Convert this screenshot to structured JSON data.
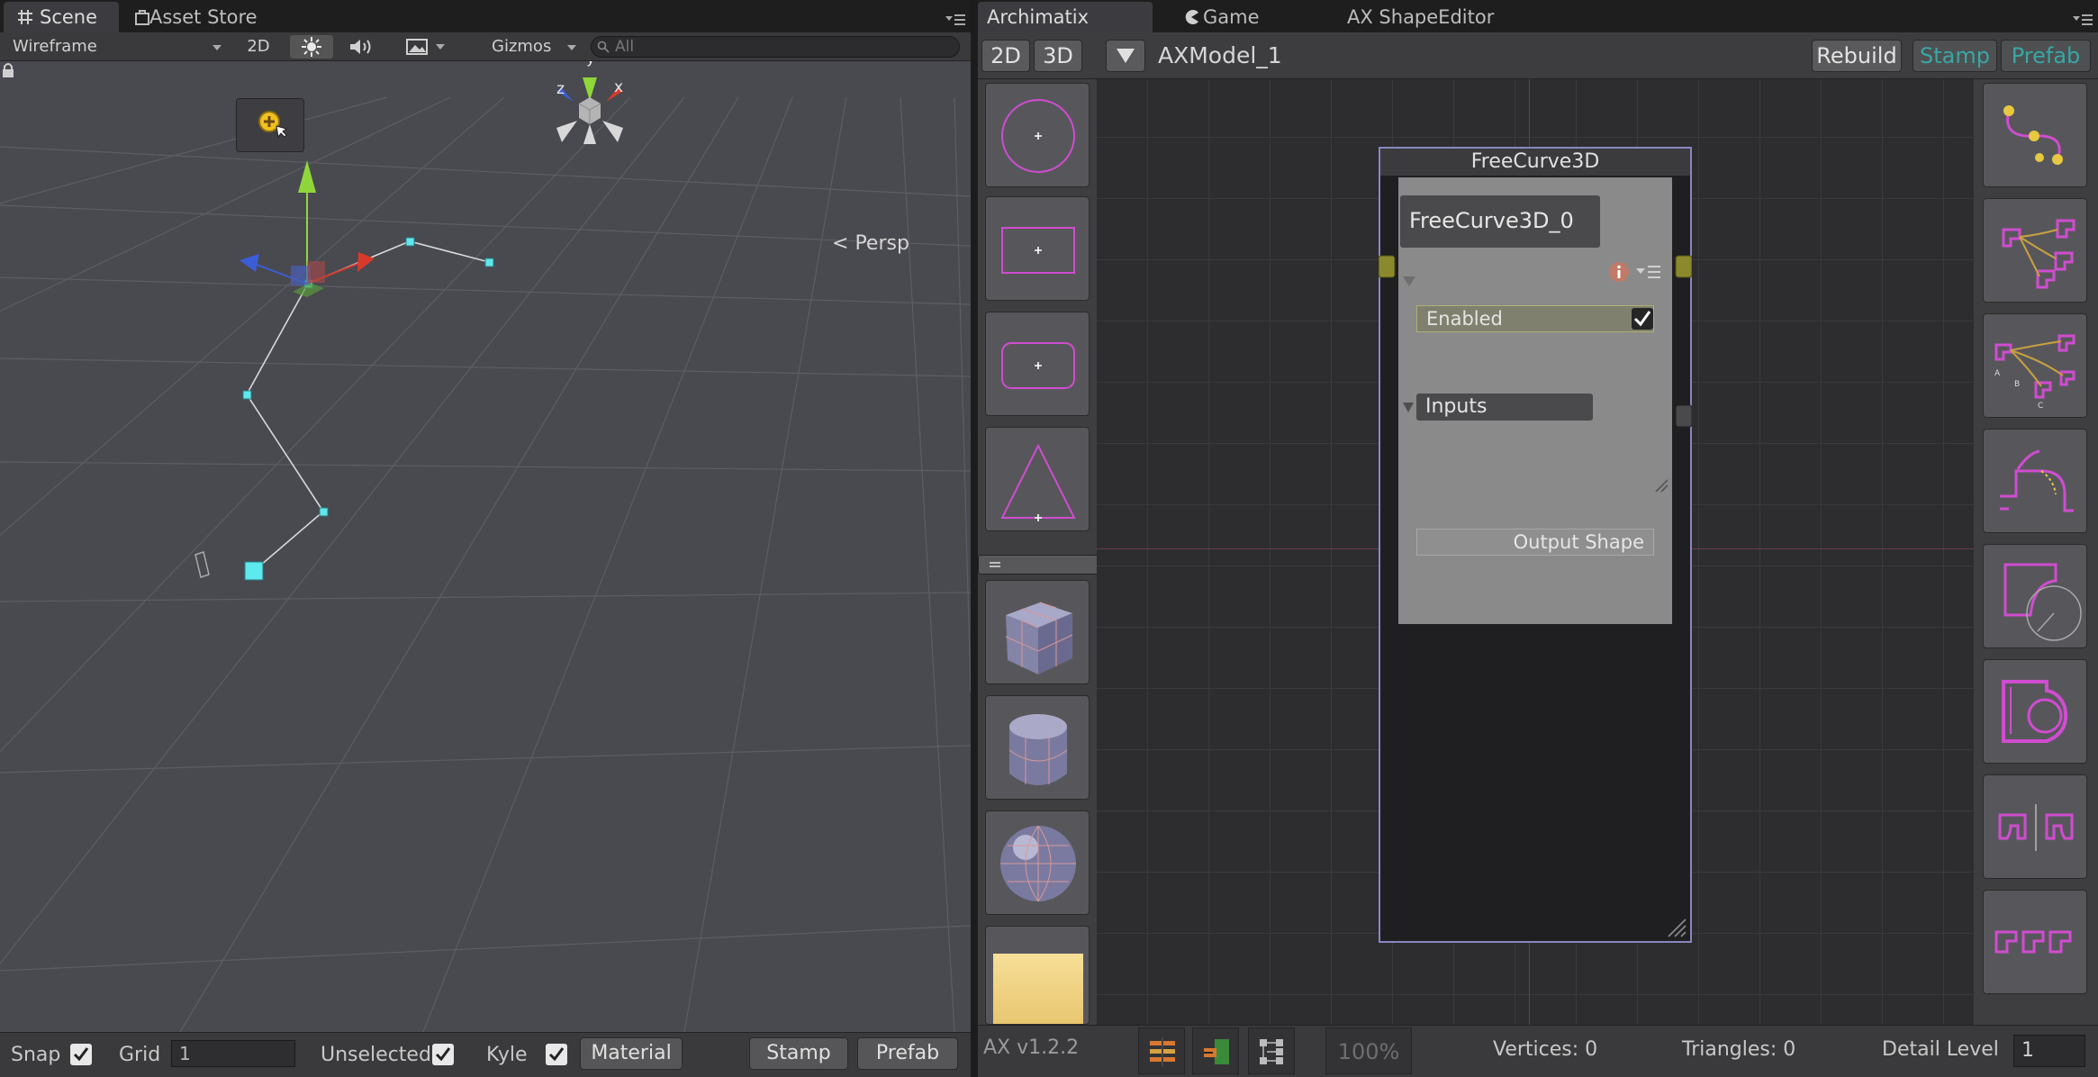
{
  "scene": {
    "tabs": [
      {
        "label": "Scene",
        "icon": "grid-icon",
        "active": true
      },
      {
        "label": "Asset Store",
        "icon": "store-bag-icon",
        "active": false
      }
    ],
    "toolbar": {
      "render_mode": "Wireframe",
      "mode_2d": "2D",
      "lighting_icon": "sun-icon",
      "audio_icon": "speaker-icon",
      "effects_icon": "image-effects-icon",
      "gizmos": "Gizmos",
      "search_placeholder": "All"
    },
    "viewport": {
      "projection": "Persp",
      "gizmo_axes": {
        "x": "x",
        "y": "y",
        "z": "z"
      }
    },
    "bottom": {
      "snap_label": "Snap",
      "snap_checked": true,
      "grid_label": "Grid",
      "grid_value": "1",
      "unselected_label": "Unselected",
      "unselected_checked": true,
      "kyle_label": "Kyle",
      "kyle_checked": true,
      "material_button": "Material",
      "stamp_button": "Stamp",
      "prefab_button": "Prefab"
    }
  },
  "editor": {
    "tabs": [
      {
        "label": "Archimatix",
        "active": true
      },
      {
        "label": "Game",
        "icon": "pacman-icon",
        "active": false
      },
      {
        "label": "AX ShapeEditor",
        "active": false
      }
    ],
    "toolbar": {
      "btn_2d": "2D",
      "btn_3d": "3D",
      "model_name": "AXModel_1",
      "rebuild": "Rebuild",
      "stamp": "Stamp",
      "prefab": "Prefab",
      "accent_teal": "#3aa6a6"
    },
    "left_library": [
      "circle-shape",
      "rectangle-shape",
      "rounded-rectangle-shape",
      "triangle-shape",
      "cube-mesh",
      "cylinder-mesh",
      "sphere-mesh",
      "material-swatch"
    ],
    "right_library": [
      "freecurve-tool",
      "shape-merger-tool",
      "shape-distributor-tool",
      "offset-curve-tool",
      "circle-corner-tool",
      "combine-shapes-tool",
      "mirror-shape-tool",
      "repeat-shape-tool"
    ],
    "node": {
      "title": "FreeCurve3D",
      "name": "FreeCurve3D_0",
      "enabled_label": "Enabled",
      "enabled_checked": true,
      "inputs_label": "Inputs",
      "output_label": "Output Shape",
      "border_color": "#8a86c0"
    },
    "status": {
      "version": "AX v1.2.2",
      "zoom": "100%",
      "vertices": "Vertices: 0",
      "triangles": "Triangles: 0",
      "detail_label": "Detail Level",
      "detail_value": "1"
    }
  },
  "colors": {
    "shape_magenta": "#d04cd0",
    "handle_cyan": "#5ee9ee",
    "gizmo_green": "#8fd63a",
    "gizmo_red": "#d83a2a",
    "gizmo_blue": "#3a5ed8"
  }
}
